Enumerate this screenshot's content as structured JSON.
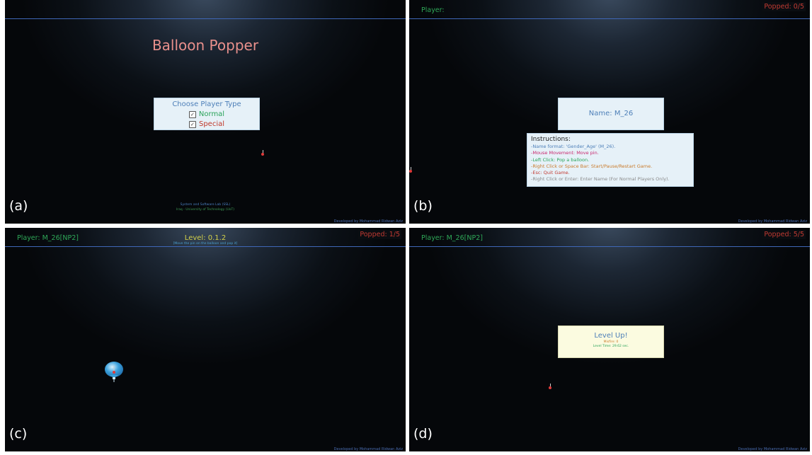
{
  "panels": {
    "a": {
      "letter": "(a)",
      "title": "Balloon Popper",
      "player_type": {
        "header": "Choose Player Type",
        "options": [
          "Normal",
          "Special"
        ]
      },
      "credits": [
        "System and Software Lab (SSL)",
        "Iraq - University of Technology (UoT)"
      ]
    },
    "b": {
      "letter": "(b)",
      "player_label": "Player:",
      "popped": "Popped: 0/5",
      "name_box": "Name: M_26",
      "instructions": {
        "title": "Instructions:",
        "lines": [
          "-Name format: 'Gender_Age' (M_26).",
          "-Mouse Movement: Move pin.",
          "-Left Click: Pop a balloon.",
          "-Right Click or Space Bar: Start/Pause/Restart Game.",
          "-Esc: Quit Game.",
          "-Right Click or Enter: Enter Name (For Normal Players Only)."
        ]
      },
      "footer": "Developed by Mohammad Ridwan Aziz"
    },
    "c": {
      "letter": "(c)",
      "player_label": "Player: M_26[NP2]",
      "level": "Level: 0.1.2",
      "level_hint": "[Move the pin on the balloon and pop it]",
      "popped": "Popped: 1/5",
      "footer": "Developed by Mohammad Ridwan Aziz"
    },
    "d": {
      "letter": "(d)",
      "player_label": "Player: M_26[NP2]",
      "popped": "Popped: 5/5",
      "levelup": {
        "title": "Level Up!",
        "misfire": "Misfire: 0",
        "time": "Level Time: 29.62 sec."
      },
      "footer": "Developed by Mohammad Ridwan Aziz"
    },
    "a_footer": "Developed by Mohammad Ridwan Aziz"
  },
  "colors": {
    "title": "#e9908c",
    "hud_player": "#2fa858",
    "hud_popped": "#c23a32",
    "level": "#d2d04a",
    "divider": "#3f67b7",
    "balloon": "#3aa0dc"
  }
}
